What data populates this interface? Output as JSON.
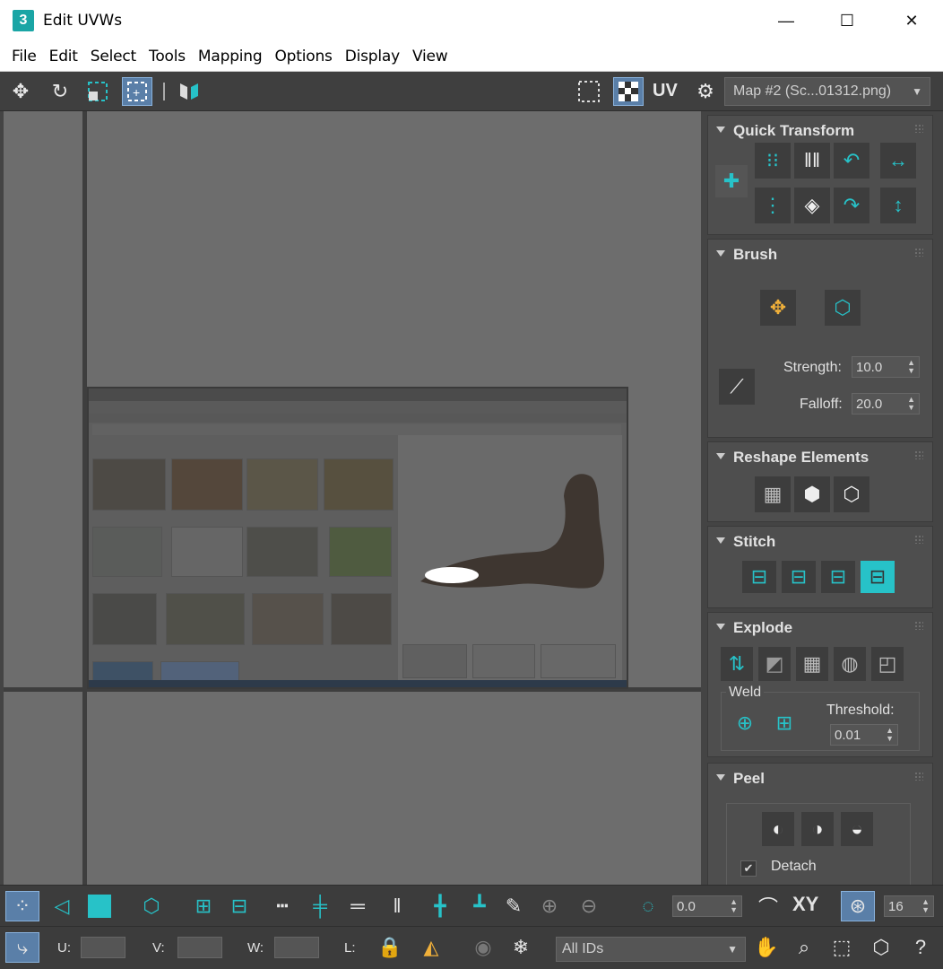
{
  "window": {
    "title": "Edit UVWs",
    "icon_text": "3",
    "minimize": "—",
    "maximize": "☐",
    "close": "✕"
  },
  "menu": {
    "items": [
      "File",
      "Edit",
      "Select",
      "Tools",
      "Mapping",
      "Options",
      "Display",
      "View"
    ]
  },
  "toolbar": {
    "uv_label": "UV",
    "map_select": "Map #2 (Sc...01312.png)"
  },
  "panels": {
    "quick_transform": {
      "title": "Quick Transform"
    },
    "brush": {
      "title": "Brush",
      "strength_label": "Strength:",
      "strength_value": "10.0",
      "falloff_label": "Falloff:",
      "falloff_value": "20.0"
    },
    "reshape": {
      "title": "Reshape Elements"
    },
    "stitch": {
      "title": "Stitch"
    },
    "explode": {
      "title": "Explode",
      "weld_label": "Weld",
      "threshold_label": "Threshold:",
      "threshold_value": "0.01"
    },
    "peel": {
      "title": "Peel",
      "detach_label": "Detach"
    }
  },
  "bottom": {
    "angle_value": "0.0",
    "xy_label": "XY",
    "snap_value": "16",
    "u_label": "U:",
    "v_label": "V:",
    "w_label": "W:",
    "l_label": "L:",
    "ids_select": "All IDs"
  },
  "colors": {
    "accent": "#27c2c8",
    "active_bg": "#5a7fa8",
    "panel_bg": "#444444",
    "viewport_bg": "#6d6d6d"
  }
}
